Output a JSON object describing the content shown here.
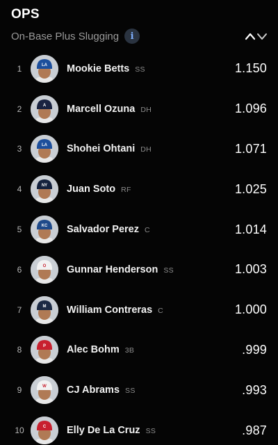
{
  "header": {
    "title": "OPS",
    "subtitle": "On-Base Plus Slugging",
    "info_glyph": "i"
  },
  "players": [
    {
      "rank": "1",
      "name": "Mookie Betts",
      "position": "SS",
      "value": "1.150",
      "cap_color": "#1d4f9c",
      "logo": "LA"
    },
    {
      "rank": "2",
      "name": "Marcell Ozuna",
      "position": "DH",
      "value": "1.096",
      "cap_color": "#1a2340",
      "logo": "A"
    },
    {
      "rank": "3",
      "name": "Shohei Ohtani",
      "position": "DH",
      "value": "1.071",
      "cap_color": "#1d4f9c",
      "logo": "LA"
    },
    {
      "rank": "4",
      "name": "Juan Soto",
      "position": "RF",
      "value": "1.025",
      "cap_color": "#14213d",
      "logo": "NY"
    },
    {
      "rank": "5",
      "name": "Salvador Perez",
      "position": "C",
      "value": "1.014",
      "cap_color": "#1f4a8a",
      "logo": "KC"
    },
    {
      "rank": "6",
      "name": "Gunnar Henderson",
      "position": "SS",
      "value": "1.003",
      "cap_color": "#f2f2f2",
      "logo": "O"
    },
    {
      "rank": "7",
      "name": "William Contreras",
      "position": "C",
      "value": "1.000",
      "cap_color": "#1c2a44",
      "logo": "M"
    },
    {
      "rank": "8",
      "name": "Alec Bohm",
      "position": "3B",
      "value": ".999",
      "cap_color": "#c8202f",
      "logo": "P"
    },
    {
      "rank": "9",
      "name": "CJ Abrams",
      "position": "SS",
      "value": ".993",
      "cap_color": "#f2f2f2",
      "logo": "W"
    },
    {
      "rank": "10",
      "name": "Elly De La Cruz",
      "position": "SS",
      "value": ".987",
      "cap_color": "#c8202f",
      "logo": "C"
    }
  ]
}
